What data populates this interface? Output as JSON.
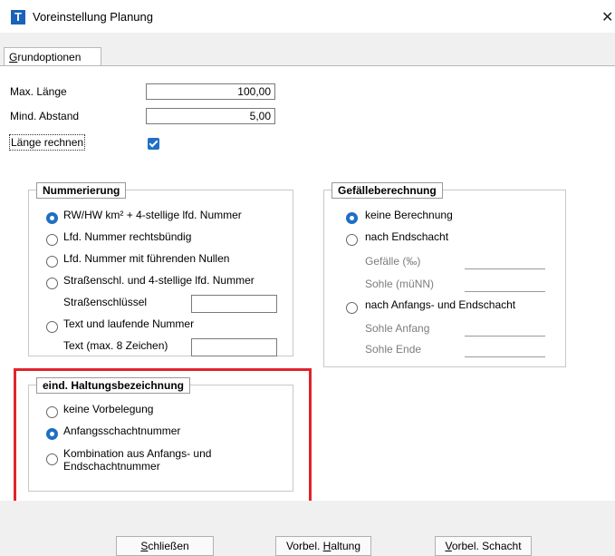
{
  "window": {
    "title": "Voreinstellung Planung",
    "icon_letter": "T",
    "close_glyph": "✕"
  },
  "tab": {
    "prefix": "G",
    "rest": "rundoptionen"
  },
  "options": {
    "max_laenge_label": "Max. Länge",
    "max_laenge_value": "100,00",
    "mind_abstand_label": "Mind. Abstand",
    "mind_abstand_value": "5,00",
    "laenge_rechnen_label": "Länge rechnen",
    "laenge_rechnen_checked": true
  },
  "nummerierung": {
    "title": "Nummerierung",
    "opt1": "RW/HW km² + 4-stellige lfd. Nummer",
    "opt2": "Lfd. Nummer rechtsbündig",
    "opt3": "Lfd. Nummer mit führenden Nullen",
    "opt4": "Straßenschl. und 4-stellige lfd. Nummer",
    "strassenschluessel_label": "Straßenschlüssel",
    "strassenschluessel_value": "",
    "opt5": "Text und laufende Nummer",
    "text_label": "Text (max. 8 Zeichen)",
    "text_value": "",
    "selected": "opt1"
  },
  "gefaelle": {
    "title": "Gefälleberechnung",
    "opt1": "keine Berechnung",
    "opt2": "nach Endschacht",
    "gefaelle_label": "Gefälle  (‰)",
    "sohle_label": "Sohle  (müNN)",
    "opt3": "nach Anfangs- und Endschacht",
    "sohle_anfang_label": "Sohle Anfang",
    "sohle_ende_label": "Sohle Ende",
    "selected": "opt1"
  },
  "haltung": {
    "title": "eind. Haltungsbezeichnung",
    "opt1": "keine Vorbelegung",
    "opt2": "Anfangsschachtnummer",
    "opt3_line1": "Kombination aus Anfangs- und",
    "opt3_line2": "Endschachtnummer",
    "selected": "opt2"
  },
  "buttons": {
    "schliessen_u": "S",
    "schliessen_rest": "chließen",
    "vorbel_haltung_pre": "Vorbel. ",
    "vorbel_haltung_u": "H",
    "vorbel_haltung_rest": "altung",
    "vorbel_schacht_u": "V",
    "vorbel_schacht_rest": "orbel. Schacht"
  },
  "colors": {
    "accent": "#1f6fc4",
    "highlight": "#e0242b"
  }
}
